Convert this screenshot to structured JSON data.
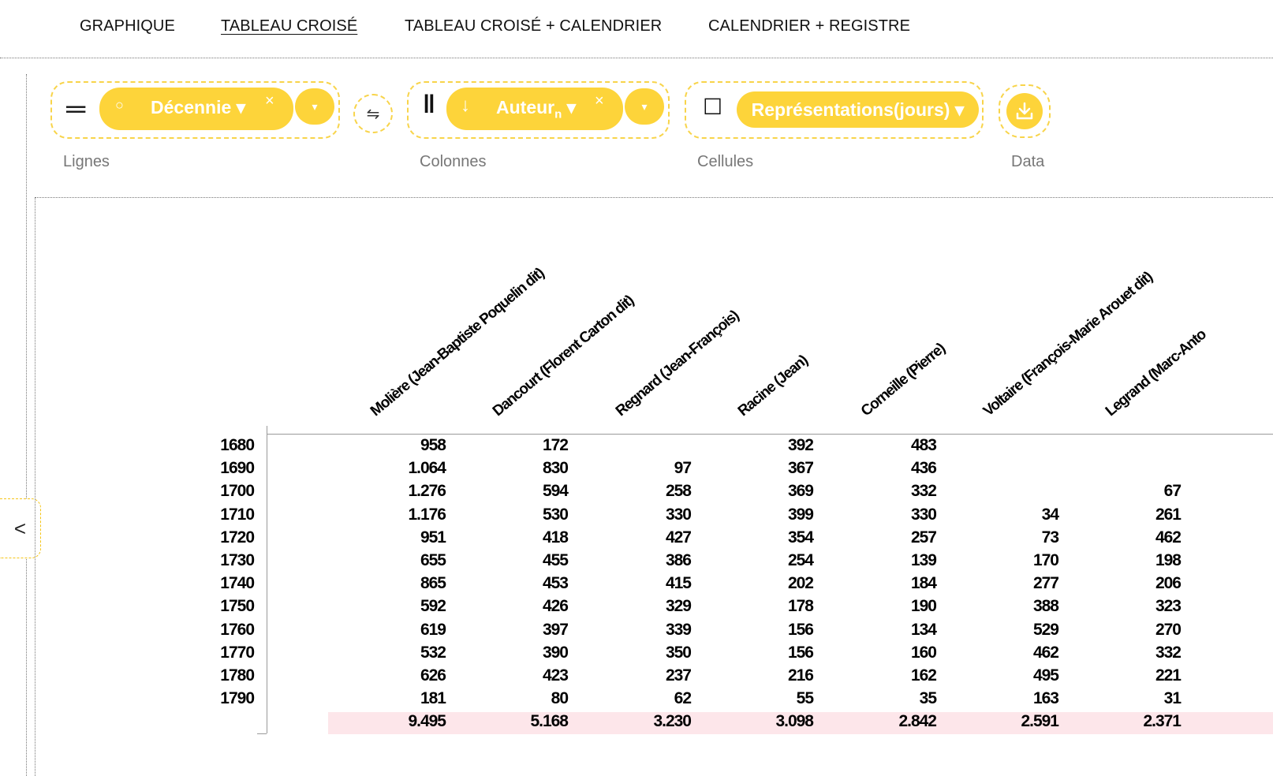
{
  "nav": {
    "items": [
      {
        "label": "GRAPHIQUE",
        "active": false
      },
      {
        "label": "TABLEAU CROISÉ",
        "active": true
      },
      {
        "label": "TABLEAU CROISÉ + CALENDRIER",
        "active": false
      },
      {
        "label": "CALENDRIER + REGISTRE",
        "active": false
      }
    ]
  },
  "controls": {
    "rows": {
      "label": "Lignes",
      "field": "Décennie ▾",
      "remove": "×",
      "menu": "▾",
      "icon_circle": "○",
      "icon_equals": "═"
    },
    "swap": {
      "icon": "⇋"
    },
    "columns": {
      "label": "Colonnes",
      "field": "Auteur",
      "field_sub": "n",
      "field_caret": " ▾",
      "remove": "×",
      "menu": "▾",
      "icon_arrow": "↓",
      "icon_bars": "‖"
    },
    "cells": {
      "label": "Cellules",
      "field": "Représentations(jours) ▾",
      "icon_checkbox": "☐"
    },
    "data": {
      "label": "Data",
      "icon": "download-icon"
    }
  },
  "sidebar": {
    "toggle": "<"
  },
  "colors": {
    "accent": "#fdd43a",
    "accent_border": "#f8d44a",
    "total_bg": "#fde6ea"
  },
  "table": {
    "columns": [
      "Molière (Jean-Baptiste Poquelin dit)",
      "Dancourt (Florent Carton dit)",
      "Regnard (Jean-François)",
      "Racine (Jean)",
      "Corneille (Pierre)",
      "Voltaire (François-Marie Arouet dit)",
      "Legrand (Marc-Anto"
    ],
    "rows": [
      {
        "label": "1680",
        "values": [
          "958",
          "172",
          "",
          "392",
          "483",
          "",
          ""
        ]
      },
      {
        "label": "1690",
        "values": [
          "1.064",
          "830",
          "97",
          "367",
          "436",
          "",
          ""
        ]
      },
      {
        "label": "1700",
        "values": [
          "1.276",
          "594",
          "258",
          "369",
          "332",
          "",
          "67"
        ]
      },
      {
        "label": "1710",
        "values": [
          "1.176",
          "530",
          "330",
          "399",
          "330",
          "34",
          "261"
        ]
      },
      {
        "label": "1720",
        "values": [
          "951",
          "418",
          "427",
          "354",
          "257",
          "73",
          "462"
        ]
      },
      {
        "label": "1730",
        "values": [
          "655",
          "455",
          "386",
          "254",
          "139",
          "170",
          "198"
        ]
      },
      {
        "label": "1740",
        "values": [
          "865",
          "453",
          "415",
          "202",
          "184",
          "277",
          "206"
        ]
      },
      {
        "label": "1750",
        "values": [
          "592",
          "426",
          "329",
          "178",
          "190",
          "388",
          "323"
        ]
      },
      {
        "label": "1760",
        "values": [
          "619",
          "397",
          "339",
          "156",
          "134",
          "529",
          "270"
        ]
      },
      {
        "label": "1770",
        "values": [
          "532",
          "390",
          "350",
          "156",
          "160",
          "462",
          "332"
        ]
      },
      {
        "label": "1780",
        "values": [
          "626",
          "423",
          "237",
          "216",
          "162",
          "495",
          "221"
        ]
      },
      {
        "label": "1790",
        "values": [
          "181",
          "80",
          "62",
          "55",
          "35",
          "163",
          "31"
        ]
      }
    ],
    "totals": [
      "9.495",
      "5.168",
      "3.230",
      "3.098",
      "2.842",
      "2.591",
      "2.371"
    ]
  }
}
